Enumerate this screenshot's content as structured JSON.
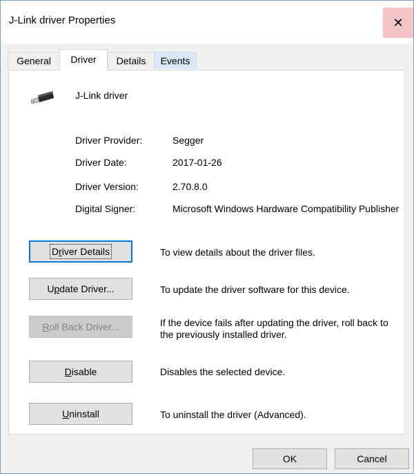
{
  "window": {
    "title": "J-Link driver Properties",
    "close_glyph": "✕"
  },
  "tabs": [
    {
      "label": "General"
    },
    {
      "label": "Driver"
    },
    {
      "label": "Details"
    },
    {
      "label": "Events"
    }
  ],
  "active_tab": "Driver",
  "device": {
    "name": "J-Link driver",
    "icon": "usb-connector-icon"
  },
  "info": [
    {
      "label": "Driver Provider:",
      "value": "Segger"
    },
    {
      "label": "Driver Date:",
      "value": "2017-01-26"
    },
    {
      "label": "Driver Version:",
      "value": "2.70.8.0"
    },
    {
      "label": "Digital Signer:",
      "value": "Microsoft Windows Hardware Compatibility Publisher"
    }
  ],
  "actions": [
    {
      "label_pre": "D",
      "label_key": "r",
      "label_post": "iver Details",
      "description": "To view details about the driver files.",
      "enabled": true,
      "focused": true
    },
    {
      "label_pre": "U",
      "label_key": "p",
      "label_post": "date Driver...",
      "description": "To update the driver software for this device.",
      "enabled": true,
      "focused": false
    },
    {
      "label_pre": "",
      "label_key": "R",
      "label_post": "oll Back Driver...",
      "description": "If the device fails after updating the driver, roll back to the previously installed driver.",
      "enabled": false,
      "focused": false
    },
    {
      "label_pre": "",
      "label_key": "D",
      "label_post": "isable",
      "description": "Disables the selected device.",
      "enabled": true,
      "focused": false
    },
    {
      "label_pre": "",
      "label_key": "U",
      "label_post": "ninstall",
      "description": "To uninstall the driver (Advanced).",
      "enabled": true,
      "focused": false
    }
  ],
  "footer": {
    "ok_label": "OK",
    "cancel_label": "Cancel"
  },
  "colors": {
    "focus_blue": "#0078d7",
    "close_hover": "#f4c4c7",
    "events_tab_hover": "#d9e8f7",
    "disabled_text": "#838383"
  }
}
